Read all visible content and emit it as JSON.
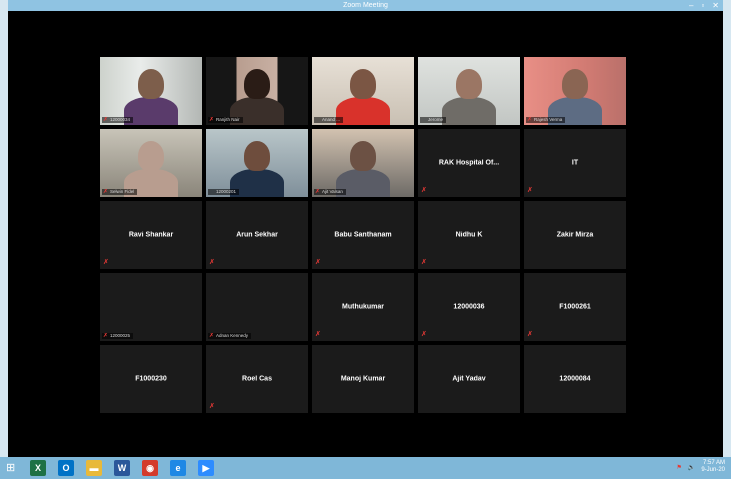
{
  "window": {
    "title": "Zoom Meeting",
    "controls": {
      "minimize": "–",
      "maximize": "▫",
      "close": "✕"
    }
  },
  "colors": {
    "titlebar": "#8fc3e2",
    "meeting_bg": "#000000",
    "tile_bg": "#1b1b1b",
    "muted_icon": "#e53935",
    "active_speaker_border": "#d8d84a",
    "taskbar": "#7fb7d8"
  },
  "participants": [
    {
      "label": "12000034",
      "video": true,
      "muted": true
    },
    {
      "label": "Ranjith Nair",
      "video": true,
      "muted": true
    },
    {
      "label": "Anand ...",
      "video": true,
      "muted": false
    },
    {
      "label": "Jerome",
      "video": true,
      "muted": false
    },
    {
      "label": "Rajesh Verma",
      "video": true,
      "muted": true
    },
    {
      "label": "Selwin Fidel",
      "video": true,
      "muted": true
    },
    {
      "label": "12000201",
      "video": true,
      "muted": false,
      "active": true
    },
    {
      "label": "Ajit Valsan",
      "video": true,
      "muted": true
    },
    {
      "label": "RAK Hospital Of...",
      "video": false,
      "muted": true
    },
    {
      "label": "IT",
      "video": false,
      "muted": true
    },
    {
      "label": "Ravi Shankar",
      "video": false,
      "muted": true
    },
    {
      "label": "Arun Sekhar",
      "video": false,
      "muted": true
    },
    {
      "label": "Babu Santhanam",
      "video": false,
      "muted": true
    },
    {
      "label": "Nidhu K",
      "video": false,
      "muted": true
    },
    {
      "label": "Zakir Mirza",
      "video": false,
      "muted": false
    },
    {
      "label": "12000025",
      "video": false,
      "muted": true,
      "bottom_label": true
    },
    {
      "label": "Adnan Kennedy",
      "video": false,
      "muted": true,
      "bottom_label": true
    },
    {
      "label": "Muthukumar",
      "video": false,
      "muted": true
    },
    {
      "label": "12000036",
      "video": false,
      "muted": true
    },
    {
      "label": "F1000261",
      "video": false,
      "muted": true
    },
    {
      "label": "F1000230",
      "video": false,
      "muted": false
    },
    {
      "label": "Roel Cas",
      "video": false,
      "muted": true
    },
    {
      "label": "Manoj Kumar",
      "video": false,
      "muted": false
    },
    {
      "label": "Ajit Yadav",
      "video": false,
      "muted": false
    },
    {
      "label": "12000084",
      "video": false,
      "muted": false
    }
  ],
  "taskbar": {
    "start_icon": "windows-start-icon",
    "apps": [
      {
        "name": "excel-icon",
        "glyph": "X",
        "color": "#1e7145"
      },
      {
        "name": "outlook-icon",
        "glyph": "O",
        "color": "#0072c6"
      },
      {
        "name": "file-explorer-icon",
        "glyph": "▬",
        "color": "#e8b93a"
      },
      {
        "name": "word-icon",
        "glyph": "W",
        "color": "#2b579a"
      },
      {
        "name": "chrome-icon",
        "glyph": "◉",
        "color": "#d33b2c"
      },
      {
        "name": "internet-explorer-icon",
        "glyph": "e",
        "color": "#1e88e5"
      },
      {
        "name": "zoom-icon",
        "glyph": "▶",
        "color": "#2d8cff"
      }
    ],
    "clock_time": "7:57 AM",
    "clock_date": "9-Jun-20"
  }
}
